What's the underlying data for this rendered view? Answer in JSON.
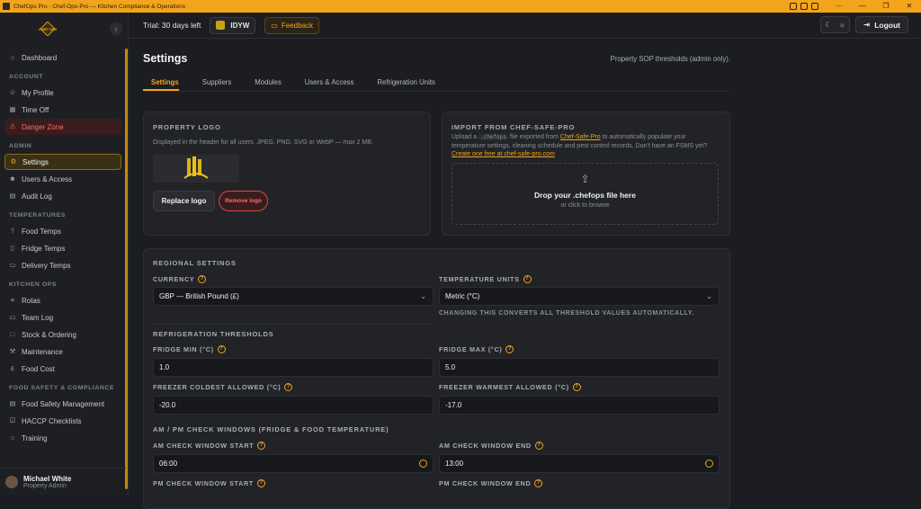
{
  "window": {
    "title": "ChefOps Pro - Chef-Ops-Pro — Kitchen Compliance & Operations"
  },
  "sidebar": {
    "brand": "CHEF OPS",
    "sections": [
      {
        "label": "",
        "items": [
          {
            "label": "Dashboard",
            "icon": "home-icon"
          }
        ]
      },
      {
        "label": "ACCOUNT",
        "items": [
          {
            "label": "My Profile",
            "icon": "user-icon"
          },
          {
            "label": "Time Off",
            "icon": "calendar-icon"
          },
          {
            "label": "Danger Zone",
            "icon": "warning-icon",
            "variant": "danger"
          }
        ]
      },
      {
        "label": "ADMIN",
        "items": [
          {
            "label": "Settings",
            "icon": "gear-icon",
            "variant": "active"
          },
          {
            "label": "Users & Access",
            "icon": "users-icon"
          },
          {
            "label": "Audit Log",
            "icon": "log-icon"
          }
        ]
      },
      {
        "label": "TEMPERATURES",
        "items": [
          {
            "label": "Food Temps",
            "icon": "thermometer-icon"
          },
          {
            "label": "Fridge Temps",
            "icon": "fridge-icon"
          },
          {
            "label": "Delivery Temps",
            "icon": "truck-icon"
          }
        ]
      },
      {
        "label": "KITCHEN OPS",
        "items": [
          {
            "label": "Rotas",
            "icon": "list-icon"
          },
          {
            "label": "Team Log",
            "icon": "chat-icon"
          },
          {
            "label": "Stock & Ordering",
            "icon": "box-icon"
          },
          {
            "label": "Maintenance",
            "icon": "wrench-icon"
          },
          {
            "label": "Food Cost",
            "icon": "pound-icon"
          }
        ]
      },
      {
        "label": "FOOD SAFETY & COMPLIANCE",
        "items": [
          {
            "label": "Food Safety Management",
            "icon": "document-icon"
          },
          {
            "label": "HACCP Checklists",
            "icon": "checklist-icon"
          },
          {
            "label": "Training",
            "icon": "graduation-icon"
          }
        ]
      }
    ],
    "user": {
      "name": "Michael White",
      "role": "Property Admin"
    }
  },
  "topbar": {
    "trial": "Trial: 30 days left",
    "org": "IDYW",
    "feedback": "Feedback",
    "logout": "Logout"
  },
  "page": {
    "title": "Settings",
    "note": "Property SOP thresholds (admin only).",
    "tabs": [
      "Settings",
      "Suppliers",
      "Modules",
      "Users & Access",
      "Refrigeration Units"
    ],
    "active_tab": "Settings"
  },
  "logo_card": {
    "heading": "PROPERTY LOGO",
    "desc": "Displayed in the header for all users. JPEG, PNG, SVG or WebP — max 2 MB.",
    "replace": "Replace logo",
    "remove": "Remove logo"
  },
  "import_card": {
    "heading": "IMPORT FROM CHEF-SAFE-PRO",
    "desc_1": "Upload a",
    "code": ".chefops",
    "desc_2": "file exported from",
    "link_1": "Chef-Safe-Pro",
    "desc_3": "to automatically populate your temperature settings, cleaning schedule and pest control records. Don't have an FSMS yet?",
    "link_2": "Create one free at chef-safe-pro.com",
    "drop_title": "Drop your .chefops file here",
    "drop_sub": "or click to browse"
  },
  "regional": {
    "heading": "REGIONAL SETTINGS",
    "currency_label": "CURRENCY",
    "currency_value": "GBP — British Pound (£)",
    "units_label": "TEMPERATURE UNITS",
    "units_value": "Metric (°C)",
    "units_hint": "CHANGING THIS CONVERTS ALL THRESHOLD VALUES AUTOMATICALLY."
  },
  "refrigeration": {
    "heading": "REFRIGERATION THRESHOLDS",
    "fridge_min_label": "FRIDGE MIN (°C)",
    "fridge_min": "1.0",
    "fridge_max_label": "FRIDGE MAX (°C)",
    "fridge_max": "5.0",
    "freezer_cold_label": "FREEZER COLDEST ALLOWED (°C)",
    "freezer_cold": "-20.0",
    "freezer_warm_label": "FREEZER WARMEST ALLOWED (°C)",
    "freezer_warm": "-17.0"
  },
  "windows": {
    "heading": "AM / PM CHECK WINDOWS (FRIDGE & FOOD TEMPERATURE)",
    "am_start_label": "AM CHECK WINDOW START",
    "am_start": "06:00",
    "am_end_label": "AM CHECK WINDOW END",
    "am_end": "13:00",
    "pm_start_label": "PM CHECK WINDOW START",
    "pm_end_label": "PM CHECK WINDOW END"
  },
  "colors": {
    "accent": "#f2a41c",
    "danger": "#ff6b6b",
    "bg": "#1b1d21"
  }
}
